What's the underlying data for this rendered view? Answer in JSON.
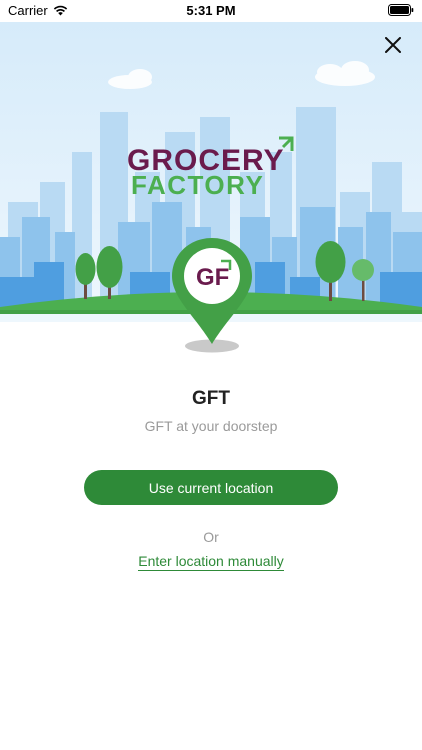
{
  "status_bar": {
    "carrier": "Carrier",
    "time": "5:31 PM"
  },
  "hero": {
    "brand_line1": "GROCERY",
    "brand_line2": "FACTORY",
    "pin_logo": "GF"
  },
  "app": {
    "title": "GFT",
    "subtitle": "GFT at your doorstep"
  },
  "actions": {
    "use_current_location": "Use current location",
    "or": "Or",
    "enter_manually": "Enter location manually"
  },
  "colors": {
    "brand_purple": "#6a1b4d",
    "brand_green": "#4caf50",
    "button_green": "#2e8a38",
    "sky": "#dceefb"
  },
  "icons": {
    "close": "close-icon",
    "wifi": "wifi-icon",
    "battery": "battery-icon",
    "pin": "location-pin-icon"
  }
}
